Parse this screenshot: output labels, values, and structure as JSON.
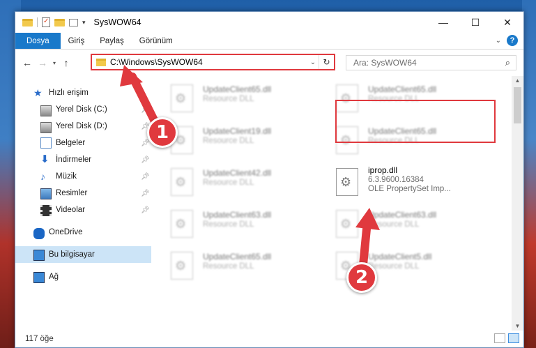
{
  "window": {
    "title": "SysWOW64",
    "controls": {
      "minimize": "—",
      "maximize": "☐",
      "close": "✕"
    }
  },
  "ribbon": {
    "tabs": [
      "Dosya",
      "Giriş",
      "Paylaş",
      "Görünüm"
    ]
  },
  "address": {
    "path": "C:\\Windows\\SysWOW64",
    "search_placeholder": "Ara: SysWOW64"
  },
  "sidebar": {
    "items": [
      {
        "label": "Hızlı erişim",
        "icon": "star-icon"
      },
      {
        "label": "Yerel Disk (C:)",
        "icon": "disk-icon"
      },
      {
        "label": "Yerel Disk (D:)",
        "icon": "disk-icon"
      },
      {
        "label": "Belgeler",
        "icon": "documents-icon"
      },
      {
        "label": "İndirmeler",
        "icon": "download-icon"
      },
      {
        "label": "Müzik",
        "icon": "music-icon"
      },
      {
        "label": "Resimler",
        "icon": "pictures-icon"
      },
      {
        "label": "Videolar",
        "icon": "videos-icon"
      },
      {
        "label": "OneDrive",
        "icon": "cloud-icon"
      },
      {
        "label": "Bu bilgisayar",
        "icon": "computer-icon"
      },
      {
        "label": "Ağ",
        "icon": "network-icon"
      }
    ]
  },
  "files": [
    {
      "name": "UpdateClient65.dll",
      "desc": "Resource DLL"
    },
    {
      "name": "UpdateClient65.dll",
      "desc": "Resource DLL"
    },
    {
      "name": "UpdateClient19.dll",
      "desc": "Resource DLL"
    },
    {
      "name": "UpdateClient65.dll",
      "desc": "Resource DLL"
    },
    {
      "name": "UpdateClient42.dll",
      "desc": "Resource DLL"
    },
    {
      "name": "iprop.dll",
      "desc": "6.3.9600.16384",
      "desc2": "OLE PropertySet Imp..."
    },
    {
      "name": "UpdateClient63.dll",
      "desc": "Resource DLL"
    },
    {
      "name": "UpdateClient63.dll",
      "desc": "Resource DLL"
    },
    {
      "name": "UpdateClient65.dll",
      "desc": "Resource DLL"
    },
    {
      "name": "UpdateClient5.dll",
      "desc": "Resource DLL"
    }
  ],
  "status": {
    "item_count": "117 öğe"
  },
  "annotations": {
    "badge1": "1",
    "badge2": "2"
  },
  "colors": {
    "accent": "#1979ca",
    "highlight": "#e0393e",
    "selected": "#cce4f7"
  }
}
